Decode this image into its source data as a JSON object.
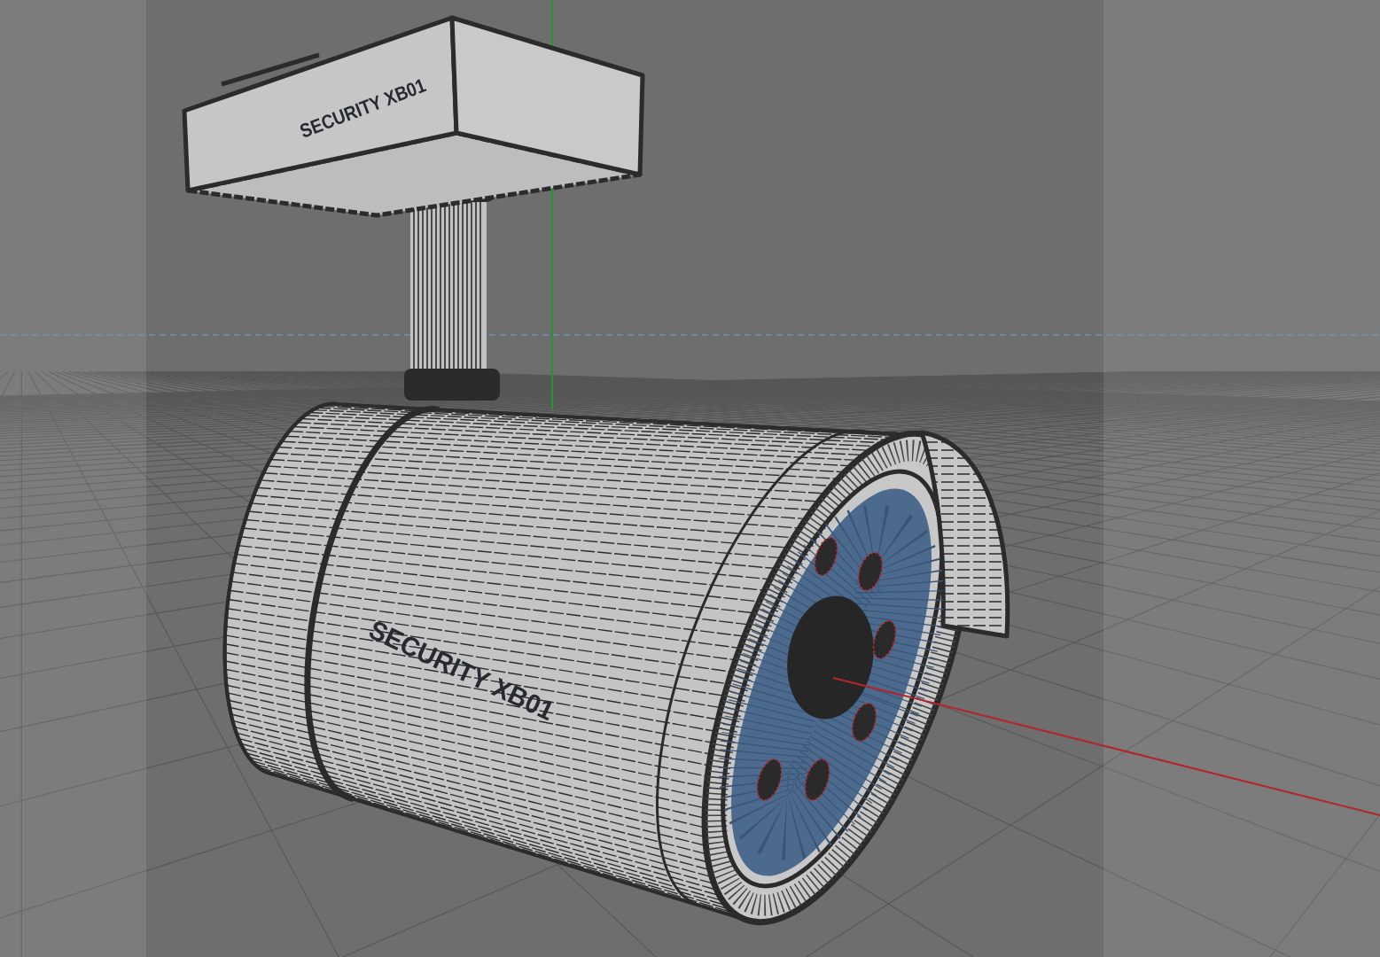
{
  "viewport": {
    "model": {
      "mount_label": "SECURITY XB01",
      "body_label": "SECURITY XB01"
    }
  }
}
